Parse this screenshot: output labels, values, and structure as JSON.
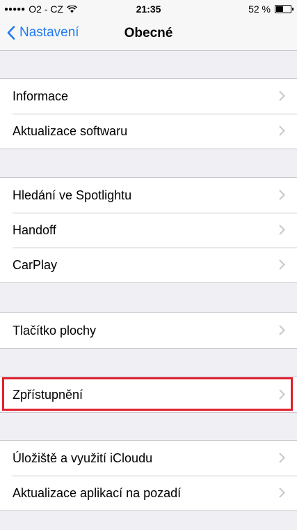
{
  "status": {
    "signal": "●●●●●",
    "carrier": "O2 - CZ",
    "time": "21:35",
    "battery": "52 %",
    "battery_level_percent": 52
  },
  "nav": {
    "back_label": "Nastavení",
    "title": "Obecné"
  },
  "groups": [
    {
      "items": [
        {
          "label": "Informace"
        },
        {
          "label": "Aktualizace softwaru"
        }
      ]
    },
    {
      "items": [
        {
          "label": "Hledání ve Spotlightu"
        },
        {
          "label": "Handoff"
        },
        {
          "label": "CarPlay"
        }
      ]
    },
    {
      "items": [
        {
          "label": "Tlačítko plochy"
        }
      ]
    },
    {
      "items": [
        {
          "label": "Zpřístupnění"
        }
      ]
    },
    {
      "items": [
        {
          "label": "Úložiště a využití iCloudu"
        },
        {
          "label": "Aktualizace aplikací na pozadí"
        }
      ]
    }
  ],
  "colors": {
    "accent": "#1f7bf2",
    "highlight": "#e0212e",
    "background": "#efeff4"
  }
}
